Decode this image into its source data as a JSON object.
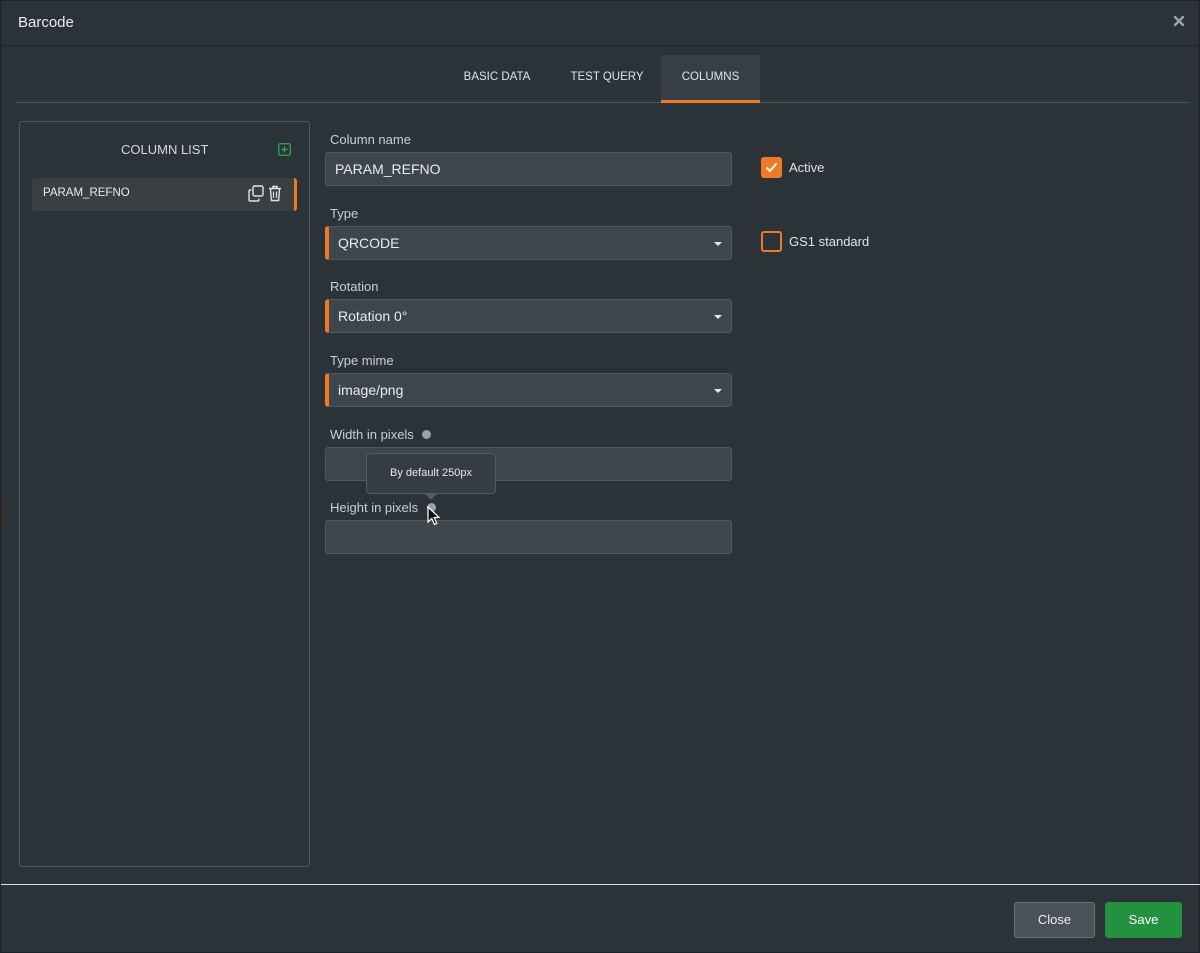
{
  "dialog": {
    "title": "Barcode"
  },
  "tabs": [
    {
      "label": "BASIC DATA",
      "active": false
    },
    {
      "label": "TEST QUERY",
      "active": false
    },
    {
      "label": "COLUMNS",
      "active": true
    }
  ],
  "column_list": {
    "title": "COLUMN LIST",
    "items": [
      {
        "label": "PARAM_REFNO",
        "selected": true
      }
    ]
  },
  "form": {
    "column_name": {
      "label": "Column name",
      "value": "PARAM_REFNO"
    },
    "type": {
      "label": "Type",
      "value": "QRCODE"
    },
    "rotation": {
      "label": "Rotation",
      "value": "Rotation 0°"
    },
    "type_mime": {
      "label": "Type mime",
      "value": "image/png"
    },
    "width": {
      "label": "Width in pixels",
      "value": ""
    },
    "height": {
      "label": "Height in pixels",
      "value": ""
    },
    "active": {
      "label": "Active",
      "checked": true
    },
    "gs1": {
      "label": "GS1 standard",
      "checked": false
    }
  },
  "tooltip": {
    "text": "By default 250px"
  },
  "footer": {
    "close_label": "Close",
    "save_label": "Save"
  },
  "colors": {
    "accent": "#f07a24",
    "save": "#23913f",
    "background": "#2b3339"
  }
}
